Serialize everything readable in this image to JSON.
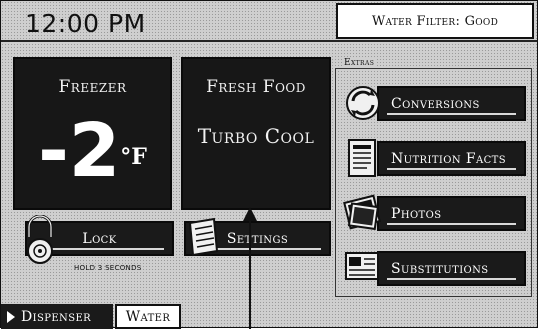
{
  "header": {
    "time": "12:00 PM",
    "water_filter_status": "Water Filter: Good"
  },
  "freezer": {
    "title": "Freezer",
    "temperature": "-2",
    "unit": "°F"
  },
  "fresh_food": {
    "title": "Fresh Food",
    "mode": "Turbo Cool"
  },
  "controls": {
    "lock_label": "Lock",
    "lock_hint": "HOLD 3 SECONDS",
    "settings_label": "Settings"
  },
  "extras": {
    "label": "Extras",
    "items": [
      {
        "label": "Conversions",
        "icon": "conversions-icon"
      },
      {
        "label": "Nutrition Facts",
        "icon": "nutrition-facts-icon"
      },
      {
        "label": "Photos",
        "icon": "photos-icon"
      },
      {
        "label": "Substitutions",
        "icon": "substitutions-icon"
      }
    ]
  },
  "dispenser": {
    "label": "Dispenser",
    "mode": "Water"
  },
  "colors": {
    "panel": "#171717",
    "background": "#cfcfcf",
    "accent_text": "#ffffff"
  }
}
